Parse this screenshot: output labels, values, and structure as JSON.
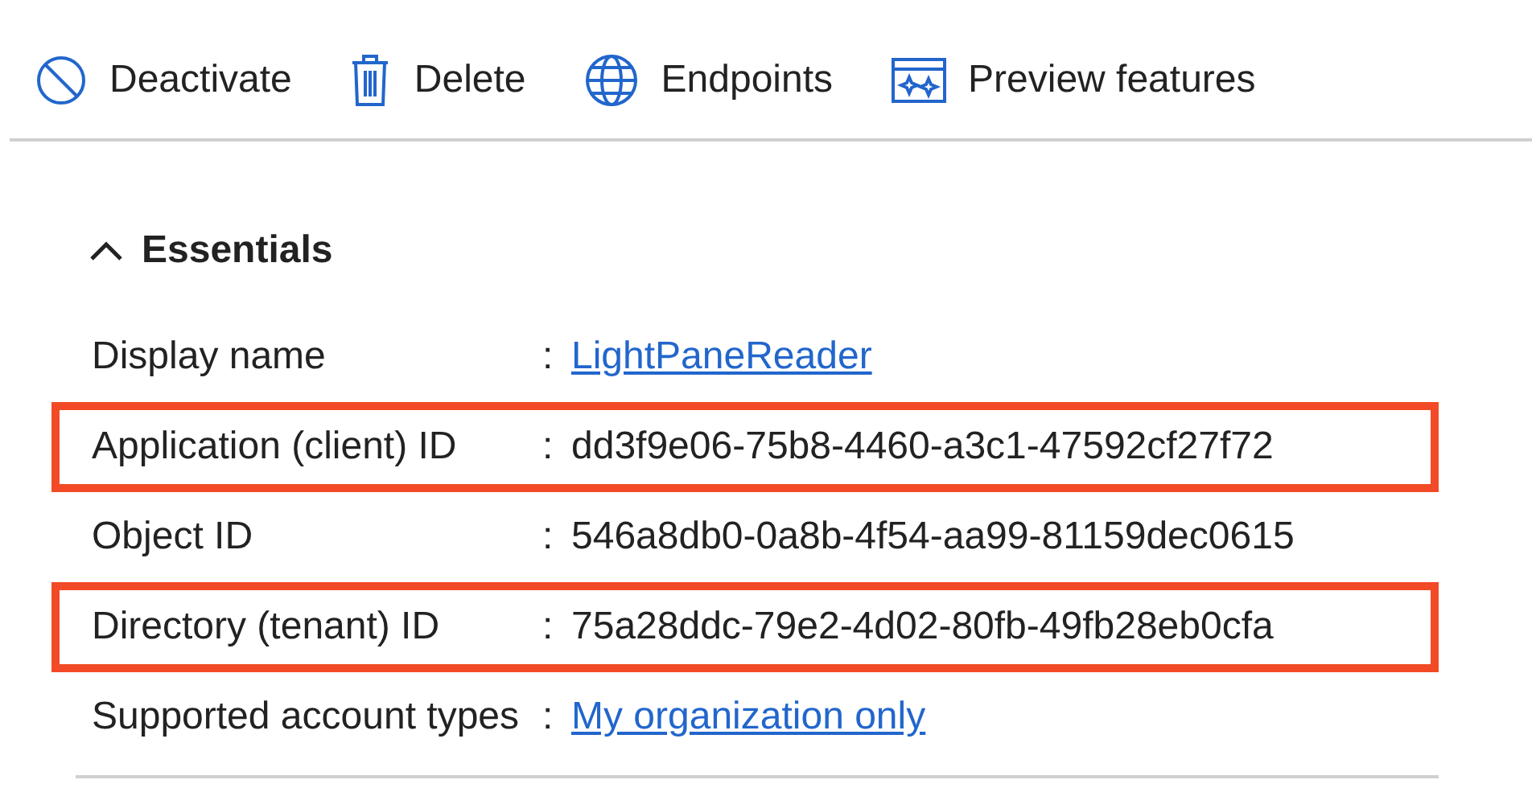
{
  "toolbar": [
    {
      "kind": "deactivate",
      "label": "Deactivate"
    },
    {
      "kind": "delete",
      "label": "Delete"
    },
    {
      "kind": "endpoints",
      "label": "Endpoints"
    },
    {
      "kind": "preview",
      "label": "Preview features"
    }
  ],
  "essentials": {
    "title": "Essentials",
    "expanded": true,
    "rows": [
      {
        "label": "Display name",
        "separator": ":",
        "value": "LightPaneReader",
        "kind": "link",
        "highlighted": false
      },
      {
        "label": "Application (client) ID",
        "separator": ":",
        "value": "dd3f9e06-75b8-4460-a3c1-47592cf27f72",
        "kind": "text",
        "highlighted": true
      },
      {
        "label": "Object ID",
        "separator": ":",
        "value": "546a8db0-0a8b-4f54-aa99-81159dec0615",
        "kind": "text",
        "highlighted": false
      },
      {
        "label": "Directory (tenant) ID",
        "separator": ":",
        "value": "75a28ddc-79e2-4d02-80fb-49fb28eb0cfa",
        "kind": "text",
        "highlighted": true
      },
      {
        "label": "Supported account types",
        "separator": ":",
        "value": "My organization only",
        "kind": "link",
        "highlighted": false
      }
    ]
  }
}
